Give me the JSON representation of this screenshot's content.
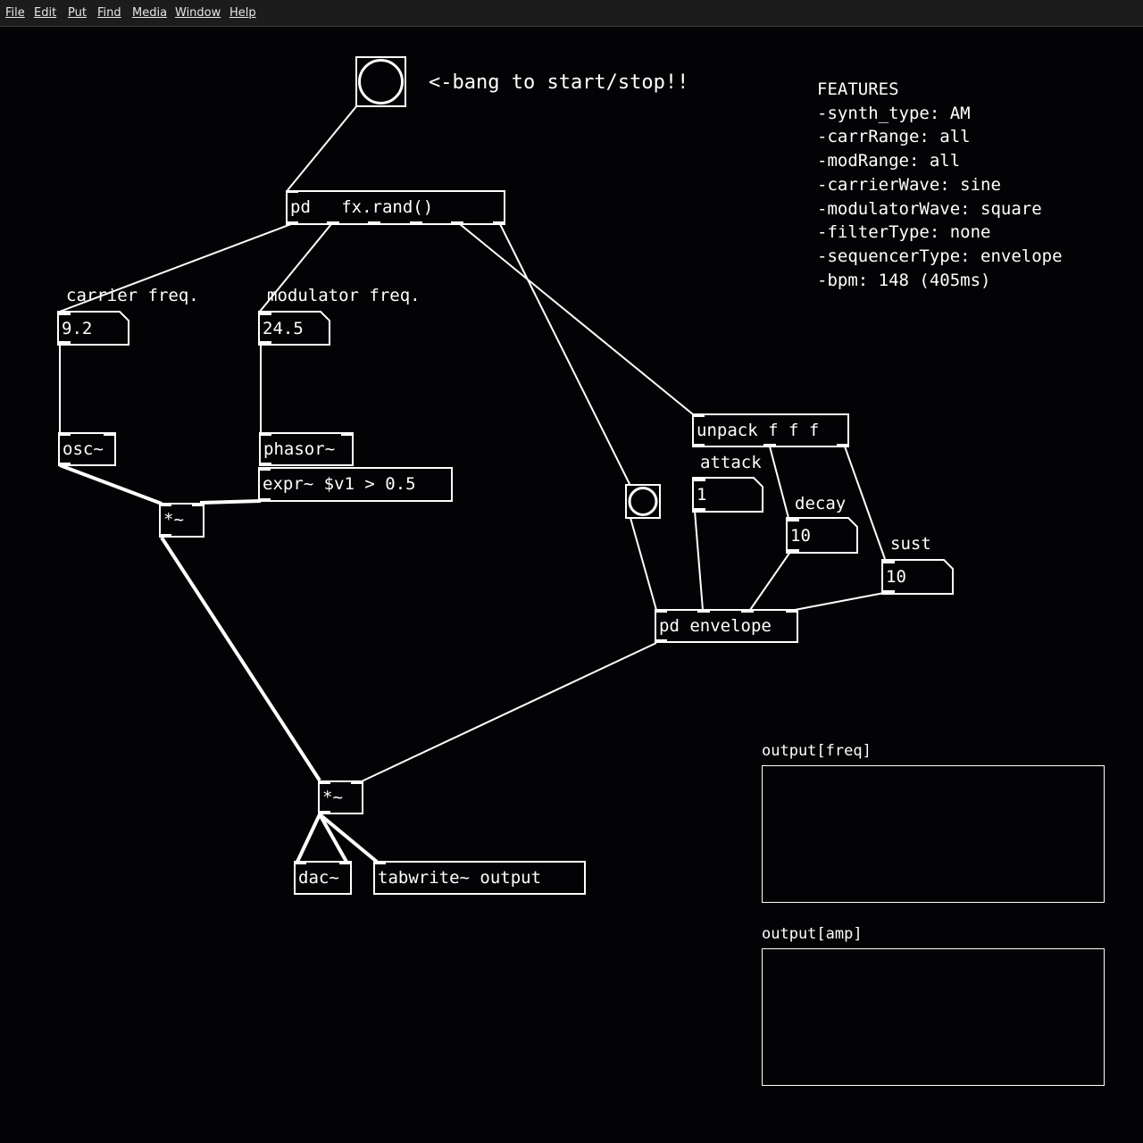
{
  "menu": [
    "File",
    "Edit",
    "Put",
    "Find",
    "Media",
    "Window",
    "Help"
  ],
  "comments": {
    "bang_hint": "<-bang to start/stop!!",
    "carrier_label": "carrier freq.",
    "modulator_label": "modulator freq."
  },
  "objects": {
    "fx_rand": "pd   fx.rand()",
    "osc": "osc~",
    "phasor": "phasor~",
    "expr": "expr~ $v1 > 0.5",
    "mult1": "*~",
    "mult2": "*~",
    "unpack": "unpack f f f",
    "pd_envelope": "pd envelope",
    "dac": "dac~",
    "tabwrite": "tabwrite~ output"
  },
  "number_boxes": {
    "carrier": "9.2",
    "modulator": "24.5",
    "attack": "1",
    "decay": "10",
    "sust": "10"
  },
  "labels": {
    "attack": "attack",
    "decay": "decay",
    "sust": "sust"
  },
  "features": {
    "title": "FEATURES",
    "lines": [
      "-synth_type: AM",
      "-carrRange: all",
      "-modRange: all",
      "-carrierWave: sine",
      "-modulatorWave: square",
      "-filterType: none",
      "-sequencerType: envelope",
      "-bpm: 148 (405ms)"
    ]
  },
  "arrays": {
    "freq": "output[freq]",
    "amp": "output[amp]"
  },
  "colors": {
    "background": "#030306",
    "foreground": "#ffffff",
    "menubar": "#1c1c1c"
  }
}
